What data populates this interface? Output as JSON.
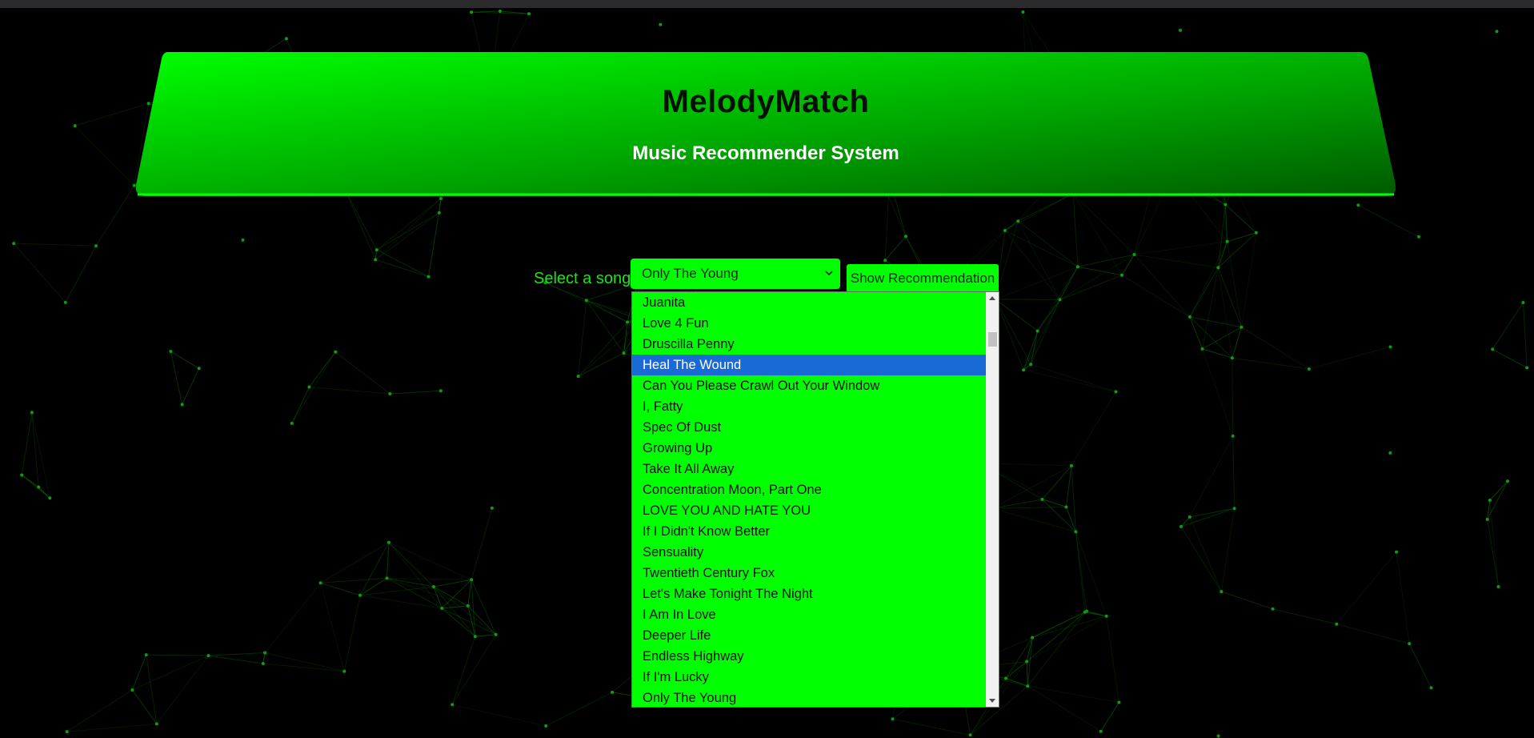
{
  "app": {
    "title": "MelodyMatch",
    "subtitle": "Music Recommender System"
  },
  "form": {
    "select_label": "Select a song:",
    "selected_value": "Only The Young",
    "button_label": "Show Recommendation"
  },
  "dropdown": {
    "highlighted_option": "Heal The Wound",
    "options": [
      "Juanita",
      "Love 4 Fun",
      "Druscilla Penny",
      "Heal The Wound",
      "Can You Please Crawl Out Your Window",
      "I, Fatty",
      "Spec Of Dust",
      "Growing Up",
      "Take It All Away",
      "Concentration Moon, Part One",
      "LOVE YOU AND HATE YOU",
      "If I Didn't Know Better",
      "Sensuality",
      "Twentieth Century Fox",
      "Let's Make Tonight The Night",
      "I Am In Love",
      "Deeper Life",
      "Endless Highway",
      "If I'm Lucky",
      "Only The Young"
    ]
  },
  "colors": {
    "background": "#000000",
    "accent_green": "#00ff00",
    "banner_dark_green": "#006400",
    "label_green": "#19e619",
    "highlight_blue": "#1a6ad6"
  },
  "icons": {
    "select_chevron": "chevron-down-icon",
    "scroll_up": "scroll-up-arrow-icon",
    "scroll_down": "scroll-down-arrow-icon"
  }
}
